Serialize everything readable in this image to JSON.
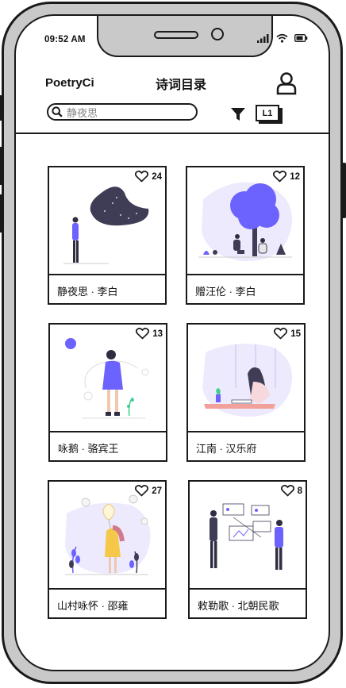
{
  "status_bar": {
    "time": "09:52 AM"
  },
  "header": {
    "app_name": "PoetryCi",
    "title": "诗词目录"
  },
  "search": {
    "placeholder": "静夜思"
  },
  "toolbar": {
    "level_label": "L1"
  },
  "colors": {
    "accent": "#6c63ff",
    "dark": "#2f2e41",
    "frame": "#c9c9c9"
  },
  "cards": [
    {
      "title": "静夜思 · 李白",
      "likes": "24"
    },
    {
      "title": "赠汪伦 · 李白",
      "likes": "12"
    },
    {
      "title": "咏鹅 · 骆宾王",
      "likes": "13"
    },
    {
      "title": "江南 · 汉乐府",
      "likes": "15"
    },
    {
      "title": "山村咏怀 · 邵雍",
      "likes": "27"
    },
    {
      "title": "敕勒歌 · 北朝民歌",
      "likes": "8"
    }
  ]
}
